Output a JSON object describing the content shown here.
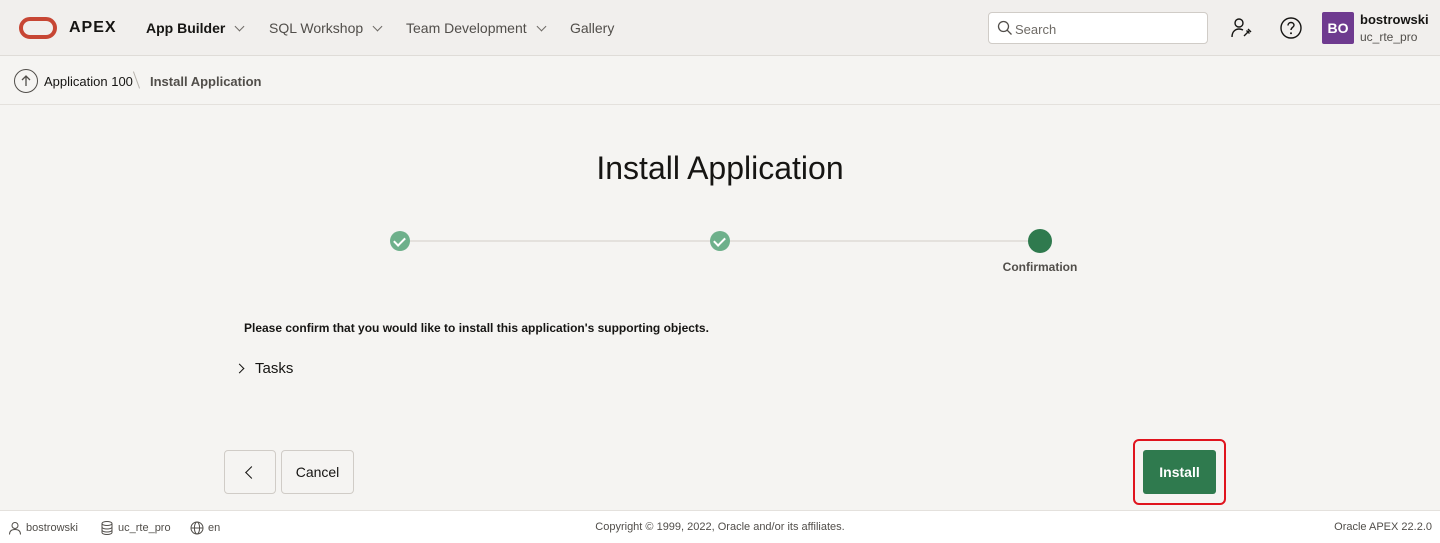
{
  "header": {
    "brand": "APEX",
    "nav": [
      {
        "label": "App Builder",
        "active": true
      },
      {
        "label": "SQL Workshop",
        "active": false
      },
      {
        "label": "Team Development",
        "active": false
      },
      {
        "label": "Gallery",
        "active": false
      }
    ],
    "search_placeholder": "Search",
    "user": {
      "initials": "BO",
      "name": "bostrowski",
      "workspace": "uc_rte_pro"
    }
  },
  "breadcrumb": {
    "parent": "Application 100",
    "current": "Install Application"
  },
  "main": {
    "title": "Install Application",
    "steps": [
      {
        "label": "",
        "state": "complete"
      },
      {
        "label": "",
        "state": "complete"
      },
      {
        "label": "Confirmation",
        "state": "current"
      }
    ],
    "confirm_message": "Please confirm that you would like to install this application's supporting objects.",
    "tasks_label": "Tasks",
    "cancel_label": "Cancel",
    "install_label": "Install"
  },
  "footer": {
    "user": "bostrowski",
    "workspace": "uc_rte_pro",
    "language": "en",
    "copyright": "Copyright © 1999, 2022, Oracle and/or its affiliates.",
    "version": "Oracle APEX 22.2.0"
  },
  "colors": {
    "oracle_red": "#c74634",
    "primary_green": "#2f7a4e",
    "step_done_green": "#6eb08b",
    "avatar_purple": "#6e3a8f",
    "highlight_red": "#e0141e"
  }
}
